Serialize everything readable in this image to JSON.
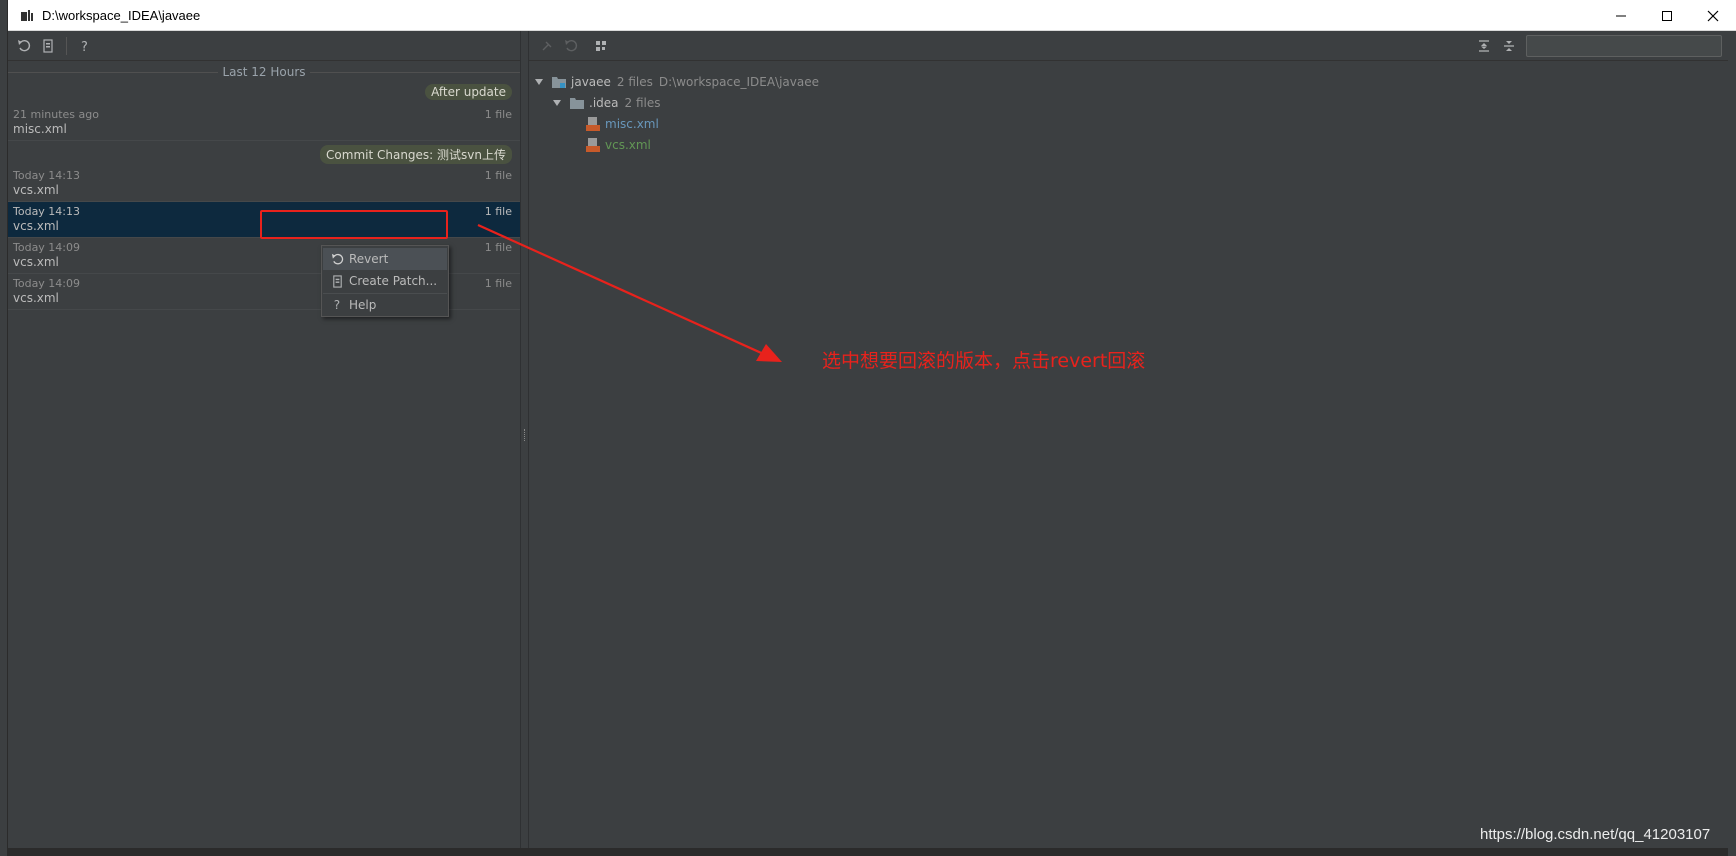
{
  "window": {
    "title": "D:\\workspace_IDEA\\javaee"
  },
  "left_panel": {
    "group_header": "Last 12 Hours",
    "tags": {
      "after_update": "After update",
      "commit": "Commit Changes: 测试svn上传"
    },
    "entries": [
      {
        "time": "21 minutes ago",
        "count": "1 file",
        "file": "misc.xml",
        "selected": false
      },
      {
        "time": "Today 14:13",
        "count": "1 file",
        "file": "vcs.xml",
        "selected": false
      },
      {
        "time": "Today 14:13",
        "count": "1 file",
        "file": "vcs.xml",
        "selected": true
      },
      {
        "time": "Today 14:09",
        "count": "1 file",
        "file": "vcs.xml",
        "selected": false
      },
      {
        "time": "Today 14:09",
        "count": "1 file",
        "file": "vcs.xml",
        "selected": false
      }
    ]
  },
  "context_menu": {
    "items": [
      {
        "label": "Revert",
        "icon": "revert-icon"
      },
      {
        "label": "Create Patch...",
        "icon": "patch-icon"
      },
      {
        "label": "Help",
        "icon": "help-icon"
      }
    ]
  },
  "tree": {
    "root": {
      "name": "javaee",
      "meta": "2 files",
      "path": "D:\\workspace_IDEA\\javaee"
    },
    "folder": {
      "name": ".idea",
      "meta": "2 files"
    },
    "files": [
      {
        "name": "misc.xml",
        "color": "#6897bb"
      },
      {
        "name": "vcs.xml",
        "color": "#629755"
      }
    ]
  },
  "annotation": {
    "text": "选中想要回滚的版本，点击revert回滚",
    "color": "#e8221c"
  },
  "watermark": "https://blog.csdn.net/qq_41203107",
  "colors": {
    "background": "#3c3f41",
    "selection": "#0d293e",
    "text": "#bbbbbb"
  }
}
